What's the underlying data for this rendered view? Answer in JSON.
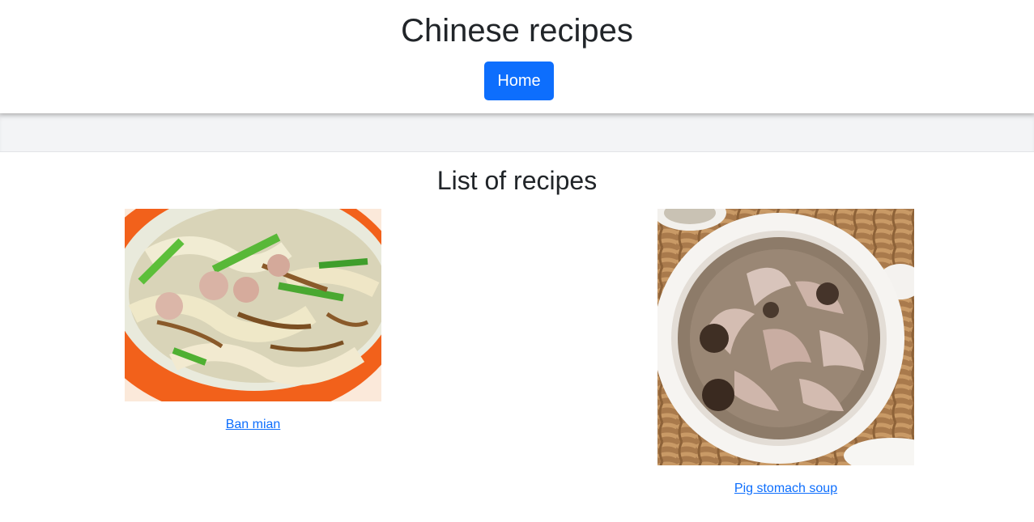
{
  "header": {
    "title": "Chinese recipes",
    "home_label": "Home"
  },
  "main": {
    "heading": "List of recipes",
    "recipes": [
      {
        "name": "Ban mian",
        "image": "ban-mian-photo"
      },
      {
        "name": "Pig stomach soup",
        "image": "pig-stomach-soup-photo"
      }
    ]
  },
  "colors": {
    "primary": "#0d6efd",
    "text": "#212529",
    "band": "#f3f4f6"
  }
}
